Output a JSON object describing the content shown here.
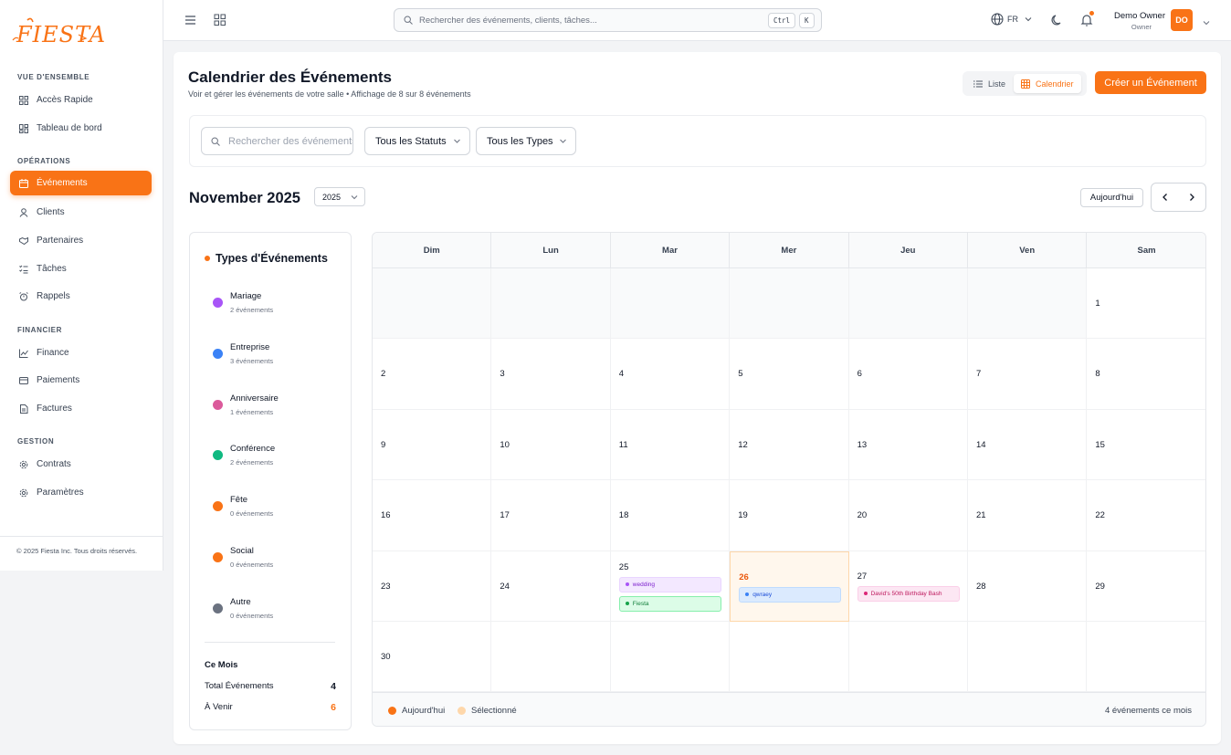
{
  "brand": {
    "logo_text": "FIESTA",
    "accent": "#f97316"
  },
  "sidebar": {
    "sections": [
      {
        "label": "VUE D'ENSEMBLE"
      },
      {
        "label": "OPÉRATIONS"
      },
      {
        "label": "FINANCIER"
      },
      {
        "label": "GESTION"
      }
    ],
    "items": [
      {
        "label": "Accès Rapide",
        "icon": "grid-icon"
      },
      {
        "label": "Tableau de bord",
        "icon": "dashboard-icon"
      },
      {
        "label": "Événements",
        "icon": "calendar-icon",
        "active": true
      },
      {
        "label": "Clients",
        "icon": "user-icon"
      },
      {
        "label": "Partenaires",
        "icon": "handshake-icon"
      },
      {
        "label": "Tâches",
        "icon": "checklist-icon"
      },
      {
        "label": "Rappels",
        "icon": "alarm-icon"
      },
      {
        "label": "Finance",
        "icon": "chart-line-icon"
      },
      {
        "label": "Paiements",
        "icon": "credit-card-icon"
      },
      {
        "label": "Factures",
        "icon": "file-icon"
      },
      {
        "label": "Contrats",
        "icon": "gear-icon"
      },
      {
        "label": "Paramètres",
        "icon": "settings-icon"
      }
    ],
    "footer": "© 2025 Fiesta Inc. Tous droits réservés."
  },
  "topbar": {
    "search_placeholder": "Rechercher des événements, clients, tâches...",
    "kbd_ctrl": "Ctrl",
    "kbd_k": "K",
    "language": "FR",
    "user_name": "Demo Owner",
    "user_role": "Owner",
    "avatar_initials": "DO"
  },
  "page": {
    "title": "Calendrier des Événements",
    "subtitle": "Voir et gérer les événements de votre salle • Affichage de 8 sur 8 événements",
    "view_list": "Liste",
    "view_calendar": "Calendrier",
    "create_button": "Créer un Événement"
  },
  "filters": {
    "search_placeholder": "Rechercher des événements",
    "status": "Tous les Statuts",
    "type": "Tous les Types"
  },
  "calendar": {
    "month_title": "November 2025",
    "year": "2025",
    "today_button": "Aujourd'hui",
    "weekdays": [
      "Dim",
      "Lun",
      "Mar",
      "Mer",
      "Jeu",
      "Ven",
      "Sam"
    ],
    "today_date": 26,
    "events": {
      "25": [
        {
          "title": "wedding",
          "bg": "#f3e8ff",
          "fg": "#7e22ce",
          "dot": "#a855f7",
          "border": "#e9d5ff"
        },
        {
          "title": "Fiesta",
          "bg": "#dcfce7",
          "fg": "#15803d",
          "dot": "#16a34a",
          "border": "#86efac"
        }
      ],
      "26": [
        {
          "title": "qwraey",
          "bg": "#dbeafe",
          "fg": "#1d4ed8",
          "dot": "#3b82f6",
          "border": "#bfdbfe"
        }
      ],
      "27": [
        {
          "title": "David's 50th Birthday Bash",
          "bg": "#fce7f3",
          "fg": "#be185d",
          "dot": "#db2777",
          "border": "#fbcfe8"
        }
      ]
    },
    "legend_today": "Aujourd'hui",
    "legend_selected": "Sélectionné",
    "month_count": "4 événements ce mois"
  },
  "event_types": {
    "title": "Types d'Événements",
    "items": [
      {
        "name": "Mariage",
        "count": "2 événements",
        "color": "#a855f7"
      },
      {
        "name": "Entreprise",
        "count": "3 événements",
        "color": "#3b82f6"
      },
      {
        "name": "Anniversaire",
        "count": "1 événements",
        "color": "#db5a9b"
      },
      {
        "name": "Conférence",
        "count": "2 événements",
        "color": "#10b981"
      },
      {
        "name": "Fête",
        "count": "0 événements",
        "color": "#f97316"
      },
      {
        "name": "Social",
        "count": "0 événements",
        "color": "#f97316"
      },
      {
        "name": "Autre",
        "count": "0 événements",
        "color": "#6b7280"
      }
    ],
    "stats_title": "Ce Mois",
    "total_label": "Total Événements",
    "total_value": "4",
    "upcoming_label": "À Venir",
    "upcoming_value": "6"
  }
}
